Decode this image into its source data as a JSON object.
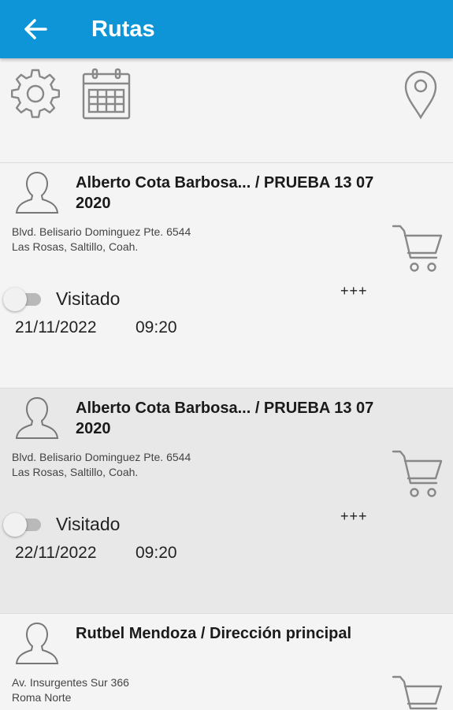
{
  "appbar": {
    "title": "Rutas",
    "back_icon": "arrow-left-icon",
    "color": "#0d95d8"
  },
  "toolbar": {
    "settings_icon": "gear-icon",
    "calendar_icon": "calendar-icon",
    "location_icon": "map-pin-icon"
  },
  "routes": [
    {
      "title": "Alberto Cota Barbosa... / PRUEBA 13 07 2020",
      "address_line1": "Blvd. Belisario Dominguez Pte. 6544",
      "address_line2": "Las Rosas, Saltillo, Coah.",
      "toggle_label": "Visitado",
      "visited": false,
      "more_label": "+++",
      "date": "21/11/2022",
      "time": "09:20"
    },
    {
      "title": "Alberto Cota Barbosa... / PRUEBA 13 07 2020",
      "address_line1": "Blvd. Belisario Dominguez Pte. 6544",
      "address_line2": "Las Rosas, Saltillo, Coah.",
      "toggle_label": "Visitado",
      "visited": false,
      "more_label": "+++",
      "date": "22/11/2022",
      "time": "09:20"
    },
    {
      "title": "Rutbel Mendoza / Dirección principal",
      "address_line1": "Av. Insurgentes Sur 366",
      "address_line2": "Roma Norte",
      "toggle_label": "",
      "visited": false,
      "more_label": "",
      "date": "",
      "time": ""
    }
  ]
}
